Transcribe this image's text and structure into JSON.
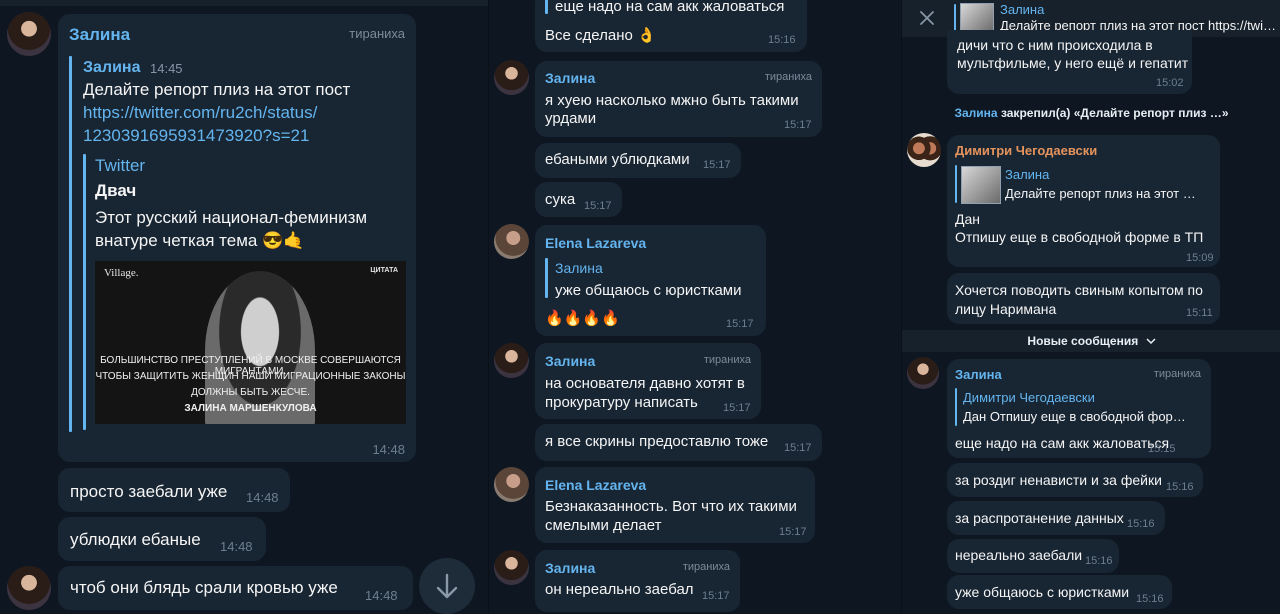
{
  "left": {
    "sender": "Залина",
    "tag": "тираниха",
    "reply": {
      "author": "Залина",
      "time": "14:45",
      "line1": "Делайте репорт плиз на этот пост",
      "link1": "https://twitter.com/ru2ch/status/",
      "link2": "1230391695931473920?s=21",
      "preview": {
        "site": "Twitter",
        "title": "Двач",
        "desc1": "Этот русский национал-феминизм",
        "desc2": "внатуре четкая тема 😎🤙",
        "image": {
          "logo": "Village.",
          "label": "ЦИТАТА",
          "quote1": "БОЛЬШИНСТВО ПРЕСТУПЛЕНИЙ В МОСКВЕ СОВЕРШАЮТСЯ МИГРАНТАМИ.",
          "quote2": "ЧТОБЫ ЗАЩИТИТЬ ЖЕНЩИН НАШИ МИГРАЦИОННЫЕ ЗАКОНЫ",
          "quote3": "ДОЛЖНЫ БЫТЬ ЖЕСЧЕ.",
          "author": "ЗАЛИНА МАРШЕНКУЛОВА"
        }
      }
    },
    "main_time": "14:48",
    "messages": [
      {
        "text": "просто заебали уже",
        "time": "14:48"
      },
      {
        "text": "ублюдки ебаные",
        "time": "14:48"
      },
      {
        "text": "чтоб они блядь срали кровью уже",
        "time": "14:48"
      }
    ],
    "scroll_icon": "arrow-down-icon"
  },
  "middle": {
    "top_partial": "еще надо на сам акк жаловаться",
    "top_msg": {
      "text": "Все сделано 👌",
      "time": "15:16"
    },
    "z1": {
      "sender": "Залина",
      "tag": "тираниха",
      "line1": "я хуею насколько мжно быть такими",
      "line2": "урдами",
      "time": "15:17"
    },
    "m2": {
      "text": "ебаными ублюдками",
      "time": "15:17"
    },
    "m3": {
      "text": "сука",
      "time": "15:17"
    },
    "e1": {
      "sender": "Elena Lazareva",
      "reply_author": "Залина",
      "reply_text": "уже общаюсь с юристками",
      "text": "🔥🔥🔥🔥",
      "time": "15:17"
    },
    "z2": {
      "sender": "Залина",
      "tag": "тираниха",
      "line1": "на основателя давно хотят в",
      "line2": "прокуратуру написать",
      "time": "15:17"
    },
    "m5": {
      "text": "я все скрины предоставлю тоже",
      "time": "15:17"
    },
    "e2": {
      "sender": "Elena Lazareva",
      "line1": "Безнаказанность. Вот что их такими",
      "line2": "смелыми делает",
      "time": "15:17"
    },
    "z3": {
      "sender": "Залина",
      "tag": "тираниха",
      "text": "он нереально заебал",
      "time": "15:17"
    }
  },
  "right": {
    "pinned_author": "Залина",
    "pinned_text": "Делайте репорт плиз на этот пост https://twit…",
    "close_icon": "close-icon",
    "top_msg": {
      "line1": "дичи что с ним происходила в",
      "line2": "мультфильме, у него ещё и гепатит",
      "time": "15:02"
    },
    "service": {
      "actor": "Залина",
      "action": "закрепил(а)",
      "object": "«Делайте репорт плиз …»"
    },
    "d1": {
      "sender": "Димитри Чегодаевски",
      "reply_author": "Залина",
      "reply_text": "Делайте репорт плиз на этот …",
      "line1": "Дан",
      "line2": "Отпишу еще в свободной форме в ТП",
      "time": "15:09"
    },
    "d2": {
      "line1": "Хочется поводить свиным копытом по",
      "line2": "лицу Наримана",
      "time": "15:11"
    },
    "new_messages": "Новые сообщения",
    "z1": {
      "sender": "Залина",
      "tag": "тираниха",
      "reply_author": "Димитри Чегодаевски",
      "reply_text": "Дан Отпишу еще в свободной фор…",
      "text": "еще надо на сам акк жаловаться",
      "time": "15:15"
    },
    "msgs": [
      {
        "text": "за роздиг ненависти и за фейки",
        "time": "15:16"
      },
      {
        "text": "за распротанение данных",
        "time": "15:16"
      },
      {
        "text": "нереально заебали",
        "time": "15:16"
      },
      {
        "text": "уже общаюсь с юристками",
        "time": "15:16"
      }
    ]
  }
}
